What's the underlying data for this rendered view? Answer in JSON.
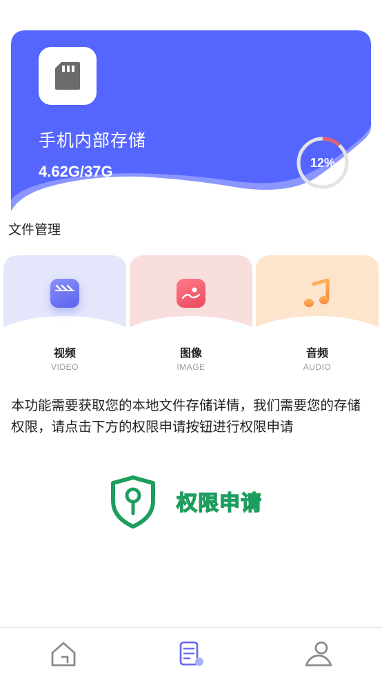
{
  "storage": {
    "title": "手机内部存储",
    "used_total": "4.62G/37G",
    "percent_label": "12%",
    "percent": 0.12,
    "icon": "sd-card-icon"
  },
  "section_title": "文件管理",
  "categories": [
    {
      "name": "视频",
      "sub": "VIDEO",
      "icon": "video-clapper-icon",
      "bg": "#e4e6fb",
      "accent": "#6d73f2"
    },
    {
      "name": "图像",
      "sub": "IMAGE",
      "icon": "image-icon",
      "bg": "#f9dede",
      "accent": "#f0506a"
    },
    {
      "name": "音频",
      "sub": "AUDIO",
      "icon": "music-note-icon",
      "bg": "#fde4cc",
      "accent": "#f5a04a"
    }
  ],
  "notice": "本功能需要获取您的本地文件存储详情，我们需要您的存储权限，请点击下方的权限申请按钮进行权限申请",
  "permission": {
    "label": "权限申请",
    "icon": "shield-key-icon"
  },
  "tabbar": {
    "items": [
      {
        "icon": "home-icon",
        "active": false
      },
      {
        "icon": "file-doc-icon",
        "active": true
      },
      {
        "icon": "user-icon",
        "active": false
      }
    ]
  },
  "colors": {
    "card": "#5566ff",
    "wave": "#8b96ff",
    "active": "#6a6ff0",
    "inactive": "#8a8a8a",
    "green": "#1e9e5e"
  }
}
